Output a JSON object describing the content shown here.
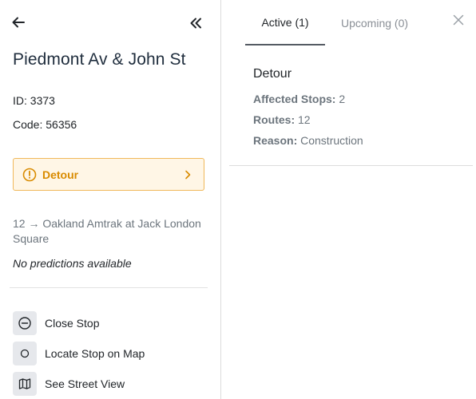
{
  "stop": {
    "name": "Piedmont Av & John St",
    "id_label": "ID: 3373",
    "code_label": "Code: 56356"
  },
  "alert_card": {
    "label": "Detour"
  },
  "route": {
    "destination": "12 → Oakland Amtrak at Jack London Square",
    "no_predictions": "No predictions available"
  },
  "actions": [
    {
      "label": "Close Stop",
      "icon": "minus-circle-icon"
    },
    {
      "label": "Locate Stop on Map",
      "icon": "circle-icon"
    },
    {
      "label": "See Street View",
      "icon": "map-icon"
    }
  ],
  "tabs": [
    {
      "label": "Active (1)"
    },
    {
      "label": "Upcoming (0)"
    }
  ],
  "alert": {
    "title": "Detour",
    "affected_stops_label": "Affected Stops:",
    "affected_stops_value": "2",
    "routes_label": "Routes:",
    "routes_value": "12",
    "reason_label": "Reason:",
    "reason_value": "Construction"
  },
  "colors": {
    "warning": "#d98b00",
    "warning_bg": "#fff6e6",
    "warning_border": "#f0b85a",
    "action_box": "#e6e8ec"
  }
}
